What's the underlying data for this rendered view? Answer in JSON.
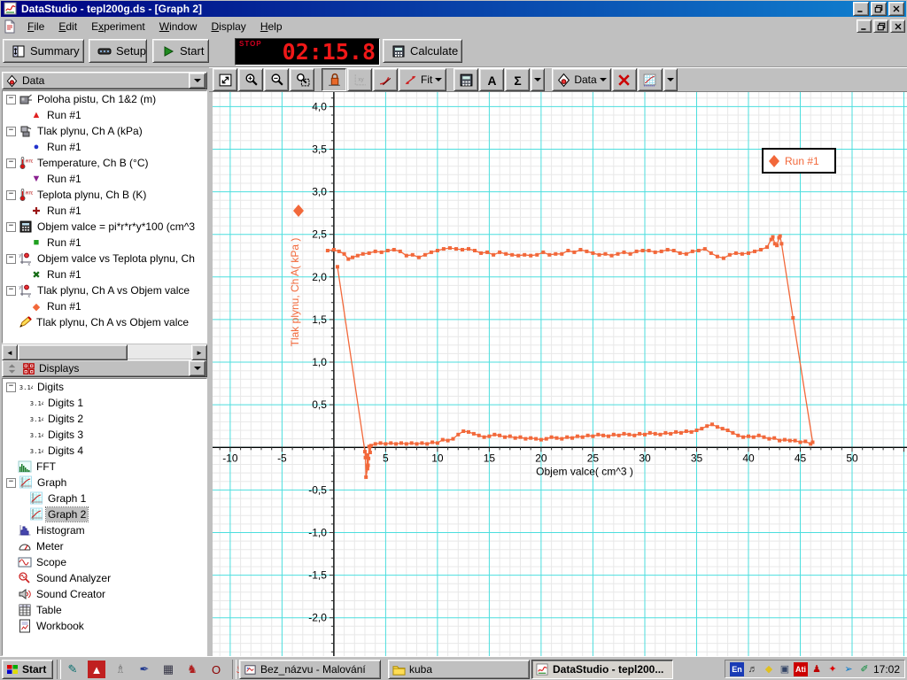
{
  "window": {
    "title": "DataStudio - tepl200g.ds - [Graph 2]"
  },
  "menu": {
    "items": [
      {
        "label": "File",
        "accel": 0
      },
      {
        "label": "Edit",
        "accel": 0
      },
      {
        "label": "Experiment",
        "accel": 1
      },
      {
        "label": "Window",
        "accel": 0
      },
      {
        "label": "Display",
        "accel": 0
      },
      {
        "label": "Help",
        "accel": 0
      }
    ]
  },
  "main_toolbar": {
    "summary_label": "Summary",
    "setup_label": "Setup",
    "start_label": "Start",
    "timer": {
      "mode": "STOP",
      "value": "02:15.8"
    },
    "calculate_label": "Calculate"
  },
  "graph_toolbar": {
    "buttons": [
      {
        "name": "scale-to-fit",
        "icon": "scale-to-fit"
      },
      {
        "name": "zoom-in",
        "icon": "zoom-in"
      },
      {
        "name": "zoom-out",
        "icon": "zoom-out"
      },
      {
        "name": "zoom-select",
        "icon": "zoom-select"
      },
      {
        "name": "smart-tool",
        "icon": "smart-tool",
        "active": true
      },
      {
        "name": "xy-tool",
        "icon": "xy-tool",
        "disabled": true
      },
      {
        "name": "slope-tool",
        "icon": "slope-tool"
      },
      {
        "name": "fit-menu",
        "icon": "fit",
        "label": "Fit",
        "dropdown": true
      },
      {
        "name": "calculate-tool",
        "icon": "calc"
      },
      {
        "name": "text-tool",
        "icon": "text-tool"
      },
      {
        "name": "statistics-menu",
        "icon": "sigma",
        "dropdown": true,
        "split": true
      },
      {
        "name": "data-menu",
        "icon": "data-diamond",
        "label": "Data",
        "dropdown": true
      },
      {
        "name": "delete-tool",
        "icon": "delete"
      },
      {
        "name": "graph-settings-menu",
        "icon": "graph-settings",
        "dropdown": true,
        "split": true
      }
    ]
  },
  "sidebar": {
    "data_panel": {
      "title": "Data",
      "items": [
        {
          "label": "Poloha pistu, Ch 1&2 (m)",
          "icon": "motion-sensor",
          "level": 0,
          "expandable": true
        },
        {
          "label": "Run #1",
          "icon": "run-triangle-up",
          "level": 1
        },
        {
          "label": "Tlak plynu, Ch A (kPa)",
          "icon": "pressure-sensor",
          "level": 0,
          "expandable": true
        },
        {
          "label": "Run #1",
          "icon": "run-circle",
          "level": 1
        },
        {
          "label": "Temperature, Ch B (°C)",
          "icon": "thermometer",
          "level": 0,
          "expandable": true
        },
        {
          "label": "Run #1",
          "icon": "run-triangle-down",
          "level": 1
        },
        {
          "label": "Teplota plynu, Ch B (K)",
          "icon": "thermometer",
          "level": 0,
          "expandable": true
        },
        {
          "label": "Run #1",
          "icon": "run-plus",
          "level": 1
        },
        {
          "label": "Objem valce = pi*r*r*y*100 (cm^3",
          "icon": "calculator",
          "level": 0,
          "expandable": true
        },
        {
          "label": "Run #1",
          "icon": "run-square",
          "level": 1
        },
        {
          "label": "Objem valce vs Teplota plynu, Ch",
          "icon": "xy-graph",
          "level": 0,
          "expandable": true
        },
        {
          "label": "Run #1",
          "icon": "run-x",
          "level": 1
        },
        {
          "label": "Tlak plynu, Ch A vs Objem valce",
          "icon": "xy-graph",
          "level": 0,
          "expandable": true
        },
        {
          "label": "Run #1",
          "icon": "run-diamond",
          "level": 1
        },
        {
          "label": "Tlak plynu, Ch A vs Objem valce",
          "icon": "pencil",
          "level": 0
        }
      ]
    },
    "displays_panel": {
      "title": "Displays",
      "items": [
        {
          "label": "Digits",
          "icon": "digits",
          "level": 0,
          "expandable": true
        },
        {
          "label": "Digits 1",
          "icon": "digits",
          "level": 1
        },
        {
          "label": "Digits 2",
          "icon": "digits",
          "level": 1
        },
        {
          "label": "Digits 3",
          "icon": "digits",
          "level": 1
        },
        {
          "label": "Digits 4",
          "icon": "digits",
          "level": 1
        },
        {
          "label": "FFT",
          "icon": "fft",
          "level": 0
        },
        {
          "label": "Graph",
          "icon": "graph",
          "level": 0,
          "expandable": true
        },
        {
          "label": "Graph 1",
          "icon": "graph",
          "level": 1
        },
        {
          "label": "Graph 2",
          "icon": "graph",
          "level": 1,
          "selected": true
        },
        {
          "label": "Histogram",
          "icon": "histogram",
          "level": 0
        },
        {
          "label": "Meter",
          "icon": "meter",
          "level": 0
        },
        {
          "label": "Scope",
          "icon": "scope",
          "level": 0
        },
        {
          "label": "Sound Analyzer",
          "icon": "sound-analyzer",
          "level": 0
        },
        {
          "label": "Sound Creator",
          "icon": "sound-creator",
          "level": 0
        },
        {
          "label": "Table",
          "icon": "table",
          "level": 0
        },
        {
          "label": "Workbook",
          "icon": "workbook",
          "level": 0
        }
      ]
    }
  },
  "chart_data": {
    "type": "scatter",
    "title": "",
    "xlabel": "Objem valce( cm^3 )",
    "ylabel": "Tlak plynu, Ch A( kPa )",
    "xlim": [
      -11.7,
      55.3
    ],
    "ylim": [
      -2.45,
      4.17
    ],
    "x_major_step": 5,
    "x_minor_step": 1,
    "y_major_step": 0.5,
    "y_minor_step": 0.1,
    "grid": {
      "major_color": "#4bdede",
      "minor_color": "#e8e8e8",
      "on": true
    },
    "x_ticks": [
      -10,
      -5,
      5,
      10,
      15,
      20,
      25,
      30,
      35,
      40,
      45,
      50
    ],
    "y_ticks": [
      4.0,
      3.5,
      3.0,
      2.5,
      2.0,
      1.5,
      1.0,
      0.5,
      -0.5,
      -1.0,
      -1.5,
      -2.0
    ],
    "legend": {
      "position": "top-right-inside",
      "entries": [
        "Run #1"
      ]
    },
    "series": [
      {
        "name": "Run #1",
        "color": "#f2683a",
        "marker": "square",
        "points": [
          [
            -0.6,
            2.31
          ],
          [
            0.0,
            2.32
          ],
          [
            0.5,
            2.3
          ],
          [
            1.0,
            2.27
          ],
          [
            1.4,
            2.21
          ],
          [
            1.8,
            2.23
          ],
          [
            2.3,
            2.25
          ],
          [
            2.8,
            2.27
          ],
          [
            3.4,
            2.28
          ],
          [
            4.0,
            2.3
          ],
          [
            4.6,
            2.29
          ],
          [
            5.2,
            2.31
          ],
          [
            5.8,
            2.32
          ],
          [
            6.4,
            2.3
          ],
          [
            7.0,
            2.25
          ],
          [
            7.6,
            2.26
          ],
          [
            8.2,
            2.23
          ],
          [
            8.8,
            2.26
          ],
          [
            9.4,
            2.29
          ],
          [
            10.0,
            2.31
          ],
          [
            10.6,
            2.33
          ],
          [
            11.2,
            2.34
          ],
          [
            11.8,
            2.33
          ],
          [
            12.4,
            2.32
          ],
          [
            13.0,
            2.33
          ],
          [
            13.6,
            2.31
          ],
          [
            14.2,
            2.28
          ],
          [
            14.8,
            2.29
          ],
          [
            15.4,
            2.26
          ],
          [
            16.0,
            2.29
          ],
          [
            16.6,
            2.27
          ],
          [
            17.2,
            2.26
          ],
          [
            17.8,
            2.25
          ],
          [
            18.4,
            2.26
          ],
          [
            19.0,
            2.25
          ],
          [
            19.6,
            2.26
          ],
          [
            20.2,
            2.29
          ],
          [
            20.8,
            2.26
          ],
          [
            21.4,
            2.27
          ],
          [
            22.0,
            2.27
          ],
          [
            22.6,
            2.31
          ],
          [
            23.2,
            2.29
          ],
          [
            23.8,
            2.32
          ],
          [
            24.4,
            2.3
          ],
          [
            25.0,
            2.28
          ],
          [
            25.6,
            2.26
          ],
          [
            26.2,
            2.27
          ],
          [
            26.8,
            2.25
          ],
          [
            27.4,
            2.27
          ],
          [
            28.0,
            2.29
          ],
          [
            28.6,
            2.27
          ],
          [
            29.2,
            2.3
          ],
          [
            29.8,
            2.31
          ],
          [
            30.4,
            2.31
          ],
          [
            31.0,
            2.29
          ],
          [
            31.6,
            2.3
          ],
          [
            32.2,
            2.32
          ],
          [
            32.8,
            2.31
          ],
          [
            33.4,
            2.28
          ],
          [
            34.0,
            2.27
          ],
          [
            34.6,
            2.3
          ],
          [
            35.2,
            2.31
          ],
          [
            35.8,
            2.33
          ],
          [
            36.4,
            2.28
          ],
          [
            37.0,
            2.24
          ],
          [
            37.6,
            2.22
          ],
          [
            38.2,
            2.26
          ],
          [
            38.8,
            2.28
          ],
          [
            39.4,
            2.27
          ],
          [
            40.0,
            2.28
          ],
          [
            40.6,
            2.3
          ],
          [
            41.2,
            2.32
          ],
          [
            41.8,
            2.35
          ],
          [
            42.2,
            2.44
          ],
          [
            42.35,
            2.47
          ],
          [
            42.55,
            2.39
          ],
          [
            42.75,
            2.37
          ],
          [
            42.95,
            2.46
          ],
          [
            43.05,
            2.48
          ],
          [
            43.2,
            2.39
          ],
          [
            44.3,
            1.52
          ],
          [
            46.2,
            0.06
          ],
          [
            46.0,
            0.04
          ],
          [
            45.5,
            0.07
          ],
          [
            45.0,
            0.06
          ],
          [
            44.5,
            0.08
          ],
          [
            44.0,
            0.08
          ],
          [
            43.5,
            0.09
          ],
          [
            43.0,
            0.08
          ],
          [
            42.5,
            0.11
          ],
          [
            42.0,
            0.1
          ],
          [
            41.5,
            0.12
          ],
          [
            41.0,
            0.14
          ],
          [
            40.5,
            0.12
          ],
          [
            40.0,
            0.13
          ],
          [
            39.5,
            0.12
          ],
          [
            39.0,
            0.14
          ],
          [
            38.5,
            0.17
          ],
          [
            38.0,
            0.2
          ],
          [
            37.5,
            0.22
          ],
          [
            37.0,
            0.24
          ],
          [
            36.5,
            0.27
          ],
          [
            36.0,
            0.25
          ],
          [
            35.5,
            0.22
          ],
          [
            35.0,
            0.2
          ],
          [
            34.5,
            0.18
          ],
          [
            34.0,
            0.19
          ],
          [
            33.5,
            0.17
          ],
          [
            33.0,
            0.18
          ],
          [
            32.5,
            0.16
          ],
          [
            32.0,
            0.17
          ],
          [
            31.5,
            0.15
          ],
          [
            31.0,
            0.16
          ],
          [
            30.5,
            0.17
          ],
          [
            30.0,
            0.15
          ],
          [
            29.5,
            0.16
          ],
          [
            29.0,
            0.14
          ],
          [
            28.5,
            0.15
          ],
          [
            28.0,
            0.16
          ],
          [
            27.5,
            0.14
          ],
          [
            27.0,
            0.15
          ],
          [
            26.5,
            0.13
          ],
          [
            26.0,
            0.14
          ],
          [
            25.5,
            0.15
          ],
          [
            25.0,
            0.13
          ],
          [
            24.5,
            0.14
          ],
          [
            24.0,
            0.12
          ],
          [
            23.5,
            0.13
          ],
          [
            23.0,
            0.11
          ],
          [
            22.5,
            0.12
          ],
          [
            22.0,
            0.1
          ],
          [
            21.5,
            0.11
          ],
          [
            21.0,
            0.12
          ],
          [
            20.5,
            0.1
          ],
          [
            20.0,
            0.09
          ],
          [
            19.5,
            0.1
          ],
          [
            19.0,
            0.11
          ],
          [
            18.5,
            0.1
          ],
          [
            18.0,
            0.12
          ],
          [
            17.5,
            0.11
          ],
          [
            17.0,
            0.13
          ],
          [
            16.5,
            0.12
          ],
          [
            16.0,
            0.14
          ],
          [
            15.5,
            0.15
          ],
          [
            15.0,
            0.13
          ],
          [
            14.5,
            0.12
          ],
          [
            14.0,
            0.14
          ],
          [
            13.5,
            0.16
          ],
          [
            13.0,
            0.18
          ],
          [
            12.5,
            0.19
          ],
          [
            12.0,
            0.15
          ],
          [
            11.5,
            0.1
          ],
          [
            11.0,
            0.08
          ],
          [
            10.5,
            0.09
          ],
          [
            10.0,
            0.05
          ],
          [
            9.5,
            0.06
          ],
          [
            9.0,
            0.04
          ],
          [
            8.5,
            0.05
          ],
          [
            8.0,
            0.04
          ],
          [
            7.5,
            0.05
          ],
          [
            7.0,
            0.04
          ],
          [
            6.5,
            0.05
          ],
          [
            6.0,
            0.04
          ],
          [
            5.5,
            0.05
          ],
          [
            5.0,
            0.04
          ],
          [
            4.5,
            0.05
          ],
          [
            4.0,
            0.04
          ],
          [
            3.6,
            0.02
          ],
          [
            3.5,
            -0.06
          ],
          [
            3.4,
            0.01
          ],
          [
            3.35,
            -0.13
          ],
          [
            3.3,
            -0.21
          ],
          [
            3.2,
            -0.09
          ],
          [
            3.25,
            -0.25
          ],
          [
            3.1,
            -0.35
          ],
          [
            3.05,
            -0.12
          ],
          [
            3.0,
            -0.05
          ],
          [
            0.35,
            2.12
          ]
        ]
      }
    ]
  },
  "taskbar": {
    "start_label": "Start",
    "quick_launch": [
      {
        "name": "journal",
        "glyph": "✎",
        "fg": "#0a6e6e"
      },
      {
        "name": "acrobat",
        "glyph": "▲",
        "fg": "#ffffff",
        "bg": "#c02020"
      },
      {
        "name": "bird",
        "glyph": "♗",
        "fg": "#777777"
      },
      {
        "name": "pen",
        "glyph": "✒",
        "fg": "#223a8f"
      },
      {
        "name": "calculator",
        "glyph": "▦",
        "fg": "#333344"
      },
      {
        "name": "dragon",
        "glyph": "♞",
        "fg": "#b02020"
      },
      {
        "name": "opera",
        "glyph": "O",
        "fg": "#8b0000"
      },
      {
        "name": "flame",
        "glyph": "♨",
        "fg": "#e03020"
      }
    ],
    "tasks": [
      {
        "label": "Bez_názvu - Malování",
        "icon": "paint"
      },
      {
        "label": "kuba",
        "icon": "folder"
      },
      {
        "label": "DataStudio - tepl200...",
        "icon": "app",
        "active": true
      }
    ],
    "tray": {
      "icons": [
        {
          "name": "keyboard-layout",
          "glyph": "En",
          "fg": "#ffffff",
          "bg": "#1a3bb5"
        },
        {
          "name": "volume",
          "glyph": "♬",
          "fg": "#333333"
        },
        {
          "name": "powerdesk",
          "glyph": "◆",
          "fg": "#e0c020"
        },
        {
          "name": "scheduler",
          "glyph": "▣",
          "fg": "#334466"
        },
        {
          "name": "ati",
          "glyph": "Ati",
          "fg": "#ffffff",
          "bg": "#cc0000"
        },
        {
          "name": "agent",
          "glyph": "♟",
          "fg": "#bb0000"
        },
        {
          "name": "powerstrip",
          "glyph": "✦",
          "fg": "#dd0000"
        },
        {
          "name": "sync",
          "glyph": "➢",
          "fg": "#0077cc"
        },
        {
          "name": "tweak",
          "glyph": "✐",
          "fg": "#008833"
        }
      ],
      "clock": "17:02"
    }
  },
  "colors": {
    "accent_orange": "#f2683a",
    "grid_cyan": "#4bdede",
    "titlebar_blue": "#000080",
    "chrome_gray": "#c0c0c0",
    "timer_red": "#f01818"
  }
}
